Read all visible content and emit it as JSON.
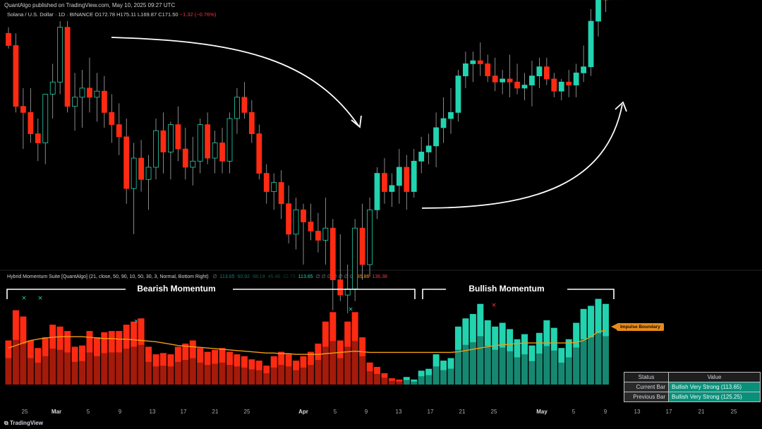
{
  "header": {
    "published": "QuantAlgo published on TradingView.com, May 10, 2025 09:27 UTC"
  },
  "symbol": {
    "name": "Solana / U.S. Dollar · 1D · BINANCE",
    "open": "O172.78",
    "high": "H175.11",
    "low": "L169.87",
    "close": "C171.50",
    "change": "−1.32 (−0.76%)"
  },
  "indicator": {
    "title": "Hybrid Momentum Suite [QuantAlgo] (21, close, 50, 90, 10, 50, 30, 3, Normal, Bottom Right)",
    "values": [
      {
        "text": "∅",
        "color": "#8a8a8a"
      },
      {
        "text": "113.65",
        "color": "#1a7f6c"
      },
      {
        "text": "90.92",
        "color": "#156a5a"
      },
      {
        "text": "68.19",
        "color": "#135a4d"
      },
      {
        "text": "45.46",
        "color": "#104c41"
      },
      {
        "text": "22.73",
        "color": "#0d3f36"
      },
      {
        "text": "113.65",
        "color": "#22d3b0"
      },
      {
        "text": "∅ ∅ ∅ ∅ ∅ ∅ ∅",
        "color": "#8a8a8a"
      },
      {
        "text": "85.86",
        "color": "#f39c12"
      },
      {
        "text": "136.38",
        "color": "#f23645"
      }
    ]
  },
  "annotations": {
    "bearish": "Bearish Momentum",
    "bullish": "Bullish Momentum",
    "impulse": "Impulse Boundary"
  },
  "x_ticks": [
    "25",
    "Mar",
    "5",
    "9",
    "13",
    "17",
    "21",
    "25",
    "Apr",
    "5",
    "9",
    "13",
    "17",
    "21",
    "25",
    "May",
    "5",
    "9",
    "13",
    "17",
    "21",
    "25"
  ],
  "status_table": {
    "header": [
      "Status",
      "Value"
    ],
    "rows": [
      {
        "key": "Current Bar",
        "value": "Bullish Very Strong (113.65)"
      },
      {
        "key": "Previous Bar",
        "value": "Bullish Very Strong (125.25)"
      }
    ]
  },
  "footer": {
    "brand": "TradingView"
  },
  "colors": {
    "bull": "#22d3b0",
    "bear": "#ff2a12",
    "boundary": "#f39c12"
  },
  "chart_data": [
    {
      "type": "candlestick",
      "title": "Solana / U.S. Dollar · 1D · BINANCE",
      "x_labels": [
        "25",
        "Mar",
        "5",
        "9",
        "13",
        "17",
        "21",
        "25",
        "Apr",
        "5",
        "9",
        "13",
        "17",
        "21",
        "25",
        "May",
        "5",
        "9"
      ],
      "ylim": [
        100,
        180
      ],
      "ohlc": [
        [
          176,
          178,
          171,
          172
        ],
        [
          172,
          176,
          150,
          152
        ],
        [
          152,
          158,
          138,
          150
        ],
        [
          150,
          158,
          140,
          143
        ],
        [
          143,
          148,
          134,
          140
        ],
        [
          140,
          152,
          133,
          156
        ],
        [
          156,
          166,
          148,
          160
        ],
        [
          160,
          180,
          156,
          178
        ],
        [
          178,
          180,
          150,
          152
        ],
        [
          152,
          163,
          144,
          155
        ],
        [
          155,
          164,
          145,
          158
        ],
        [
          158,
          168,
          150,
          155
        ],
        [
          155,
          163,
          147,
          157
        ],
        [
          157,
          162,
          145,
          150
        ],
        [
          150,
          156,
          140,
          146
        ],
        [
          146,
          153,
          136,
          142
        ],
        [
          142,
          148,
          120,
          125
        ],
        [
          125,
          140,
          110,
          135
        ],
        [
          135,
          141,
          124,
          128
        ],
        [
          128,
          136,
          118,
          132
        ],
        [
          132,
          148,
          128,
          144
        ],
        [
          144,
          150,
          130,
          137
        ],
        [
          137,
          147,
          128,
          146
        ],
        [
          146,
          152,
          134,
          138
        ],
        [
          138,
          145,
          128,
          132
        ],
        [
          132,
          142,
          126,
          134
        ],
        [
          134,
          148,
          130,
          146
        ],
        [
          146,
          150,
          133,
          135
        ],
        [
          135,
          144,
          130,
          140
        ],
        [
          140,
          145,
          130,
          134
        ],
        [
          134,
          150,
          130,
          148
        ],
        [
          148,
          158,
          143,
          155
        ],
        [
          155,
          160,
          148,
          150
        ],
        [
          150,
          154,
          140,
          143
        ],
        [
          143,
          146,
          128,
          130
        ],
        [
          130,
          133,
          120,
          124
        ],
        [
          124,
          130,
          118,
          127
        ],
        [
          127,
          131,
          115,
          120
        ],
        [
          120,
          126,
          107,
          110
        ],
        [
          110,
          122,
          105,
          118
        ],
        [
          118,
          120,
          100,
          114
        ],
        [
          114,
          120,
          108,
          111
        ],
        [
          111,
          117,
          104,
          108
        ],
        [
          108,
          122,
          100,
          112
        ],
        [
          112,
          115,
          85,
          95
        ],
        [
          95,
          110,
          88,
          90
        ],
        [
          90,
          100,
          84,
          92
        ],
        [
          92,
          115,
          88,
          112
        ],
        [
          112,
          120,
          95,
          100
        ],
        [
          100,
          122,
          96,
          118
        ],
        [
          118,
          132,
          115,
          130
        ],
        [
          130,
          135,
          120,
          124
        ],
        [
          124,
          130,
          119,
          126
        ],
        [
          126,
          138,
          120,
          132
        ],
        [
          132,
          136,
          118,
          124
        ],
        [
          124,
          138,
          122,
          134
        ],
        [
          134,
          142,
          130,
          137
        ],
        [
          137,
          143,
          133,
          139
        ],
        [
          139,
          150,
          132,
          145
        ],
        [
          145,
          155,
          140,
          148
        ],
        [
          148,
          158,
          143,
          150
        ],
        [
          150,
          164,
          147,
          162
        ],
        [
          162,
          170,
          158,
          166
        ],
        [
          166,
          170,
          160,
          167
        ],
        [
          167,
          173,
          162,
          166
        ],
        [
          166,
          169,
          160,
          162
        ],
        [
          162,
          168,
          157,
          160
        ],
        [
          160,
          164,
          156,
          161
        ],
        [
          161,
          169,
          155,
          160
        ],
        [
          160,
          166,
          156,
          158
        ],
        [
          158,
          163,
          154,
          159
        ],
        [
          159,
          167,
          152,
          162
        ],
        [
          162,
          168,
          158,
          165
        ],
        [
          165,
          168,
          159,
          161
        ],
        [
          161,
          163,
          155,
          157
        ],
        [
          157,
          161,
          154,
          160
        ],
        [
          160,
          164,
          155,
          159
        ],
        [
          159,
          166,
          155,
          163
        ],
        [
          163,
          172,
          160,
          165
        ],
        [
          165,
          184,
          162,
          180
        ],
        [
          180,
          190,
          175,
          188
        ],
        [
          188,
          191,
          183,
          187
        ]
      ]
    },
    {
      "type": "bar",
      "title": "Hybrid Momentum Suite [QuantAlgo]",
      "ylim": [
        0,
        140
      ],
      "values": [
        -70,
        -118,
        -108,
        -70,
        -58,
        -75,
        -95,
        -92,
        -85,
        -60,
        -62,
        -85,
        -75,
        -83,
        -85,
        -85,
        -95,
        -100,
        -105,
        -60,
        -48,
        -50,
        -48,
        -60,
        -65,
        -70,
        -58,
        -52,
        -55,
        -58,
        -52,
        -48,
        -45,
        -40,
        -38,
        -30,
        -45,
        -52,
        -48,
        -38,
        -45,
        -52,
        -65,
        -100,
        -115,
        -70,
        -100,
        -115,
        -75,
        -35,
        -28,
        -18,
        -10,
        -8,
        12,
        8,
        22,
        25,
        48,
        38,
        42,
        92,
        105,
        112,
        128,
        102,
        92,
        98,
        88,
        72,
        80,
        62,
        82,
        102,
        90,
        58,
        72,
        98,
        120,
        125,
        136,
        128
      ],
      "boundary": [
        58,
        62,
        66,
        70,
        72,
        74,
        75,
        76,
        76,
        76,
        76,
        75,
        74,
        73,
        73,
        72,
        72,
        71,
        70,
        69,
        68,
        66,
        64,
        62,
        61,
        60,
        59,
        58,
        57,
        56,
        55,
        54,
        53,
        52,
        51,
        50,
        50,
        49,
        49,
        48,
        48,
        48,
        48,
        49,
        50,
        51,
        52,
        53,
        52,
        51,
        51,
        51,
        51,
        51,
        51,
        51,
        51,
        51,
        51,
        51,
        51,
        52,
        54,
        56,
        58,
        60,
        62,
        63,
        64,
        65,
        66,
        66,
        66,
        66,
        66,
        66,
        66,
        67,
        70,
        76,
        84,
        86
      ]
    }
  ]
}
